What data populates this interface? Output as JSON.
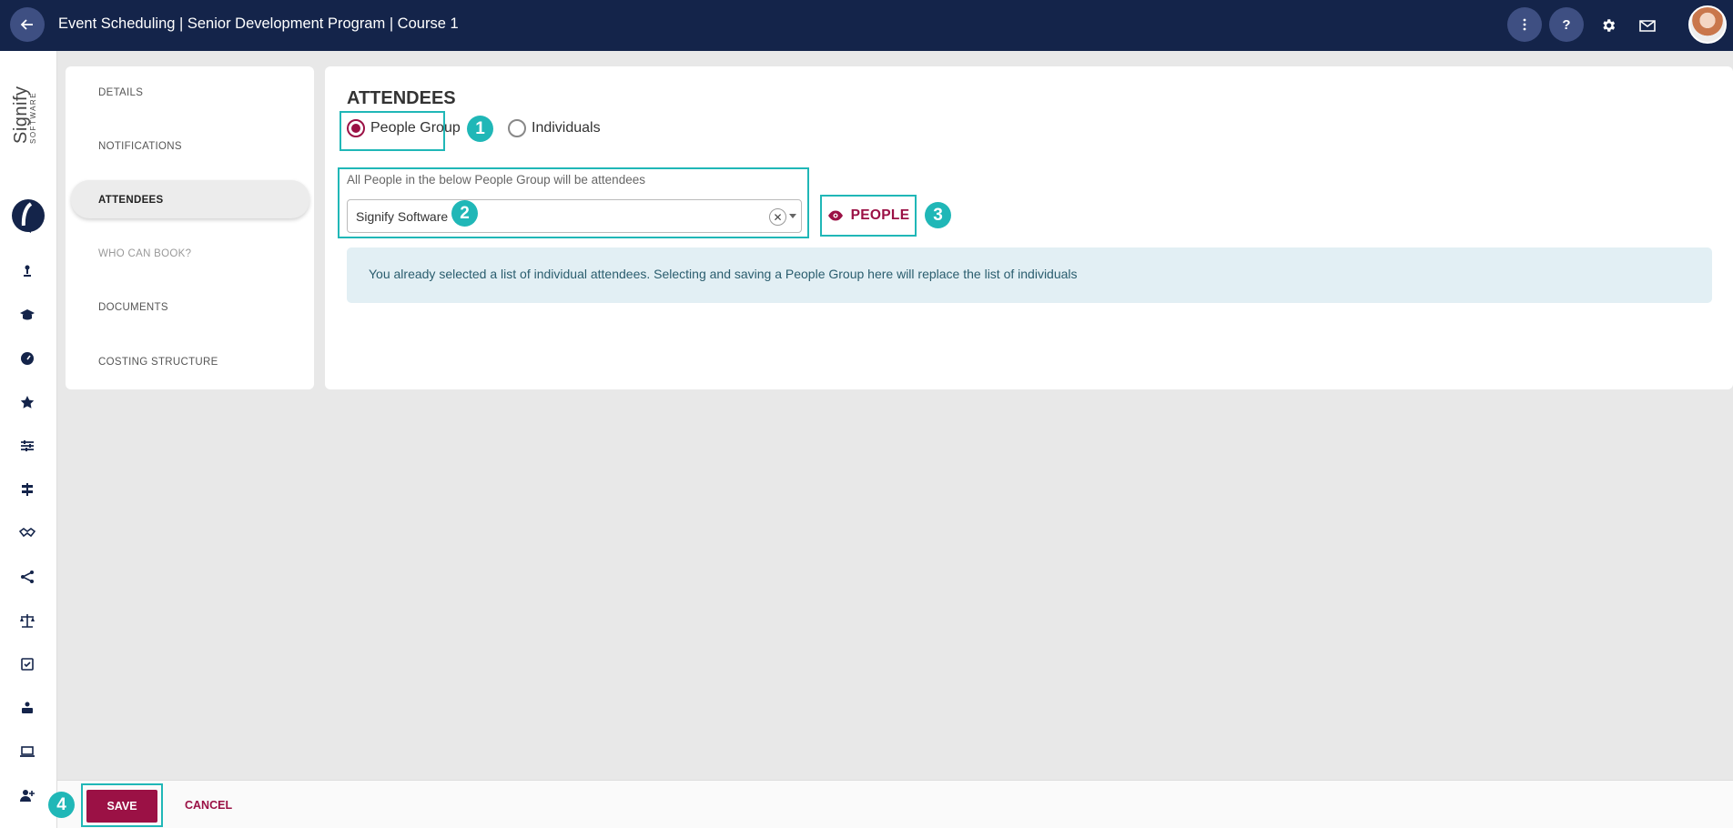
{
  "header": {
    "title": "Event Scheduling | Senior Development Program | Course 1",
    "back_icon": "arrow-left-icon",
    "more_icon": "more-vertical-icon",
    "help_label": "?",
    "settings_icon": "gear-icon",
    "mail_icon": "mail-icon",
    "avatar": "user-avatar"
  },
  "logo": {
    "word": "Signify",
    "sub": "SOFTWARE"
  },
  "rail": {
    "icons": [
      "megaphone-icon",
      "person-upload-icon",
      "graduation-cap-icon",
      "gauge-icon",
      "star-icon",
      "sliders-icon",
      "signpost-icon",
      "handshake-icon",
      "network-icon",
      "scales-icon",
      "checkbox-calendar-icon",
      "person-box-icon",
      "laptop-icon",
      "add-person-icon"
    ]
  },
  "tabs": [
    {
      "label": "DETAILS",
      "state": "normal"
    },
    {
      "label": "NOTIFICATIONS",
      "state": "normal"
    },
    {
      "label": "ATTENDEES",
      "state": "active"
    },
    {
      "label": "WHO CAN BOOK?",
      "state": "disabled"
    },
    {
      "label": "DOCUMENTS",
      "state": "normal"
    },
    {
      "label": "COSTING STRUCTURE",
      "state": "normal"
    }
  ],
  "main": {
    "title": "ATTENDEES",
    "radio_people_group": "People Group",
    "radio_individuals": "Individuals",
    "selected_radio": "People Group",
    "helper": "All People in the below People Group will be attendees",
    "select_value": "Signify Software",
    "people_button": "PEOPLE",
    "alert": "You already selected a list of individual attendees. Selecting and saving a People Group here will replace the list of individuals"
  },
  "badges": [
    "1",
    "2",
    "3",
    "4"
  ],
  "footer": {
    "save": "SAVE",
    "cancel": "CANCEL"
  },
  "colors": {
    "topbar": "#14244a",
    "accent": "#9b1145",
    "highlight": "#20b7b7",
    "alert_bg": "#e2eff4"
  }
}
